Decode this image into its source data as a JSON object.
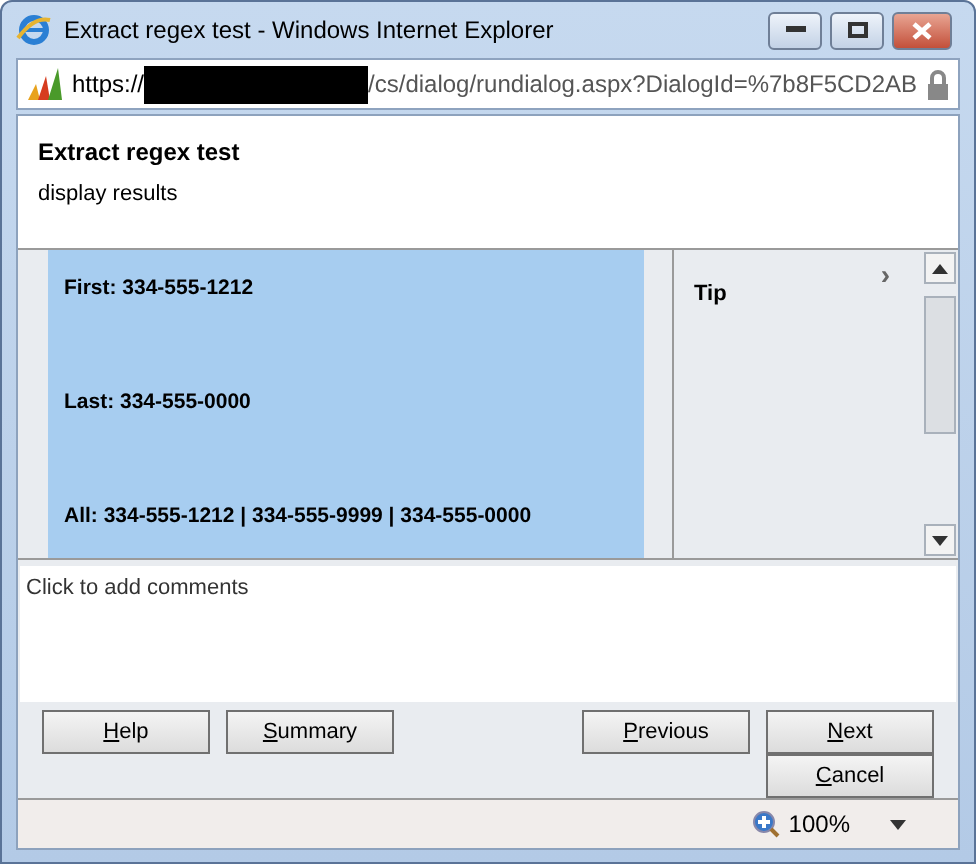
{
  "window": {
    "title": "Extract regex test - Windows Internet Explorer"
  },
  "address_bar": {
    "prefix": "https://",
    "redacted": true,
    "suffix": "/cs/dialog/rundialog.aspx?DialogId=%7b8F5CD2AB",
    "secure": true
  },
  "header": {
    "title": "Extract regex test",
    "subtitle": "display results"
  },
  "results": [
    "First: 334-555-1212",
    "Last: 334-555-0000",
    "All: 334-555-1212 | 334-555-9999 | 334-555-0000"
  ],
  "tip_panel": {
    "title": "Tip",
    "chevron": "›"
  },
  "comments": {
    "placeholder": "Click to add comments"
  },
  "left_buttons": [
    {
      "label": "Help",
      "mnemonic": true
    },
    {
      "label": "Summary",
      "mnemonic": true
    }
  ],
  "right_buttons": [
    {
      "label": "Previous",
      "mnemonic": true
    },
    {
      "label": "Next",
      "mnemonic": true
    }
  ],
  "cancel_button": {
    "label": "Cancel",
    "mnemonic": true
  },
  "status_bar": {
    "zoom": "100%"
  }
}
